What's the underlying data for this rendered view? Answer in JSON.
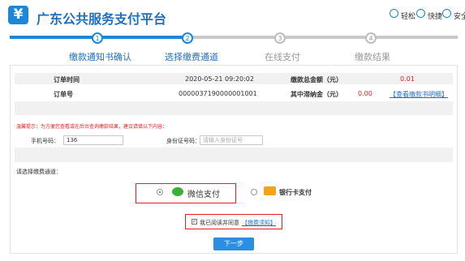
{
  "header": {
    "logo_glyph": "¥",
    "title": "广东公共服务支付平台",
    "links": [
      "轻松",
      "快捷",
      "安全"
    ]
  },
  "steps": [
    {
      "number": "1",
      "label": "缴款通知书确认",
      "status": "done"
    },
    {
      "number": "2",
      "label": "选择缴费通道",
      "status": "done"
    },
    {
      "number": "3",
      "label": "在线支付",
      "status": "todo"
    },
    {
      "number": "4",
      "label": "缴款结果",
      "status": "todo"
    }
  ],
  "order": {
    "time_label": "订单时间",
    "time_value": "2020-05-21 09:20:02",
    "total_label": "缴款总金额（元）",
    "total_value": "0.01",
    "number_label": "订单号",
    "number_value": "0000037190000001001",
    "late_fee_label": "其中滞纳金（元）",
    "late_fee_value": "0.00",
    "view_notice_link": "【查看缴款书明细】"
  },
  "tip": {
    "text": "温馨提示：为方便您查看或在后台查询缴款结果，建议请填以下内容："
  },
  "form": {
    "phone_label": "手机号码：",
    "phone_value": "136",
    "id_label": "身份证号码：",
    "id_placeholder": "请输入身份证号"
  },
  "channel": {
    "prompt": "请选择缴费通道：",
    "options": [
      {
        "label": "微信支付",
        "selected": true,
        "icon": "wechat-icon"
      },
      {
        "label": "银行卡支付",
        "selected": false,
        "icon": "bank-card-icon"
      }
    ]
  },
  "agreement": {
    "check_mark": "✓",
    "text": "我已阅读并同意",
    "link": "【缴费须知】"
  },
  "next_button": "下一步",
  "colors": {
    "brand": "#1e86d6",
    "alert": "#e02020",
    "wechat": "#3cb035"
  }
}
